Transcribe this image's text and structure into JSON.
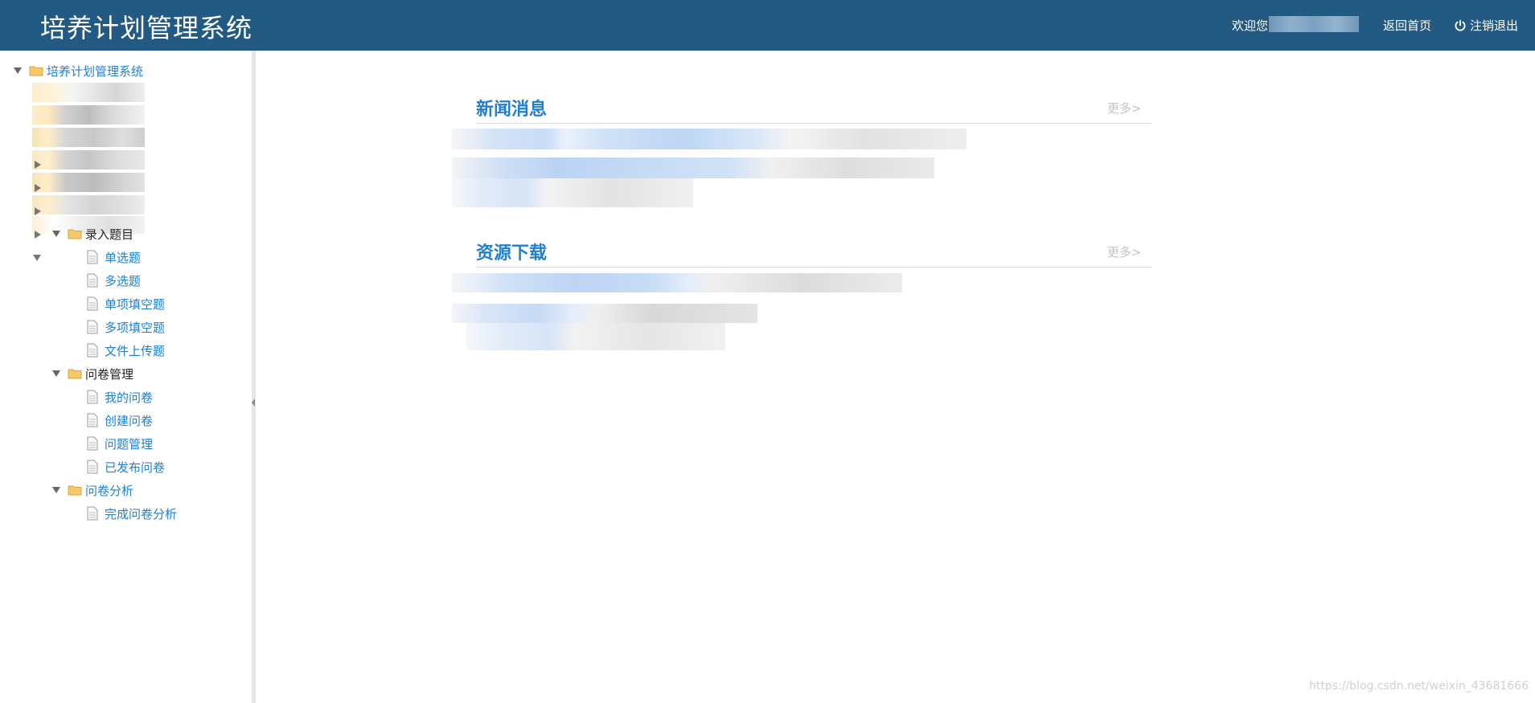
{
  "header": {
    "title": "培养计划管理系统",
    "welcome": "欢迎您",
    "home_link": "返回首页",
    "logout_link": "注销退出",
    "bg_color": "#235a84"
  },
  "sidebar": {
    "root_label": "培养计划管理系统",
    "groups": [
      {
        "label": "录入题目",
        "items": [
          "单选题",
          "多选题",
          "单项填空题",
          "多项填空题",
          "文件上传题"
        ]
      },
      {
        "label": "问卷管理",
        "items": [
          "我的问卷",
          "创建问卷",
          "问题管理",
          "已发布问卷"
        ]
      },
      {
        "label": "问卷分析",
        "items": [
          "完成问卷分析"
        ]
      }
    ]
  },
  "main": {
    "news": {
      "title": "新闻消息",
      "more": "更多>"
    },
    "downloads": {
      "title": "资源下载",
      "more": "更多>"
    }
  },
  "watermark": "https://blog.csdn.net/weixin_43681666",
  "accent_color": "#1f7fd1"
}
